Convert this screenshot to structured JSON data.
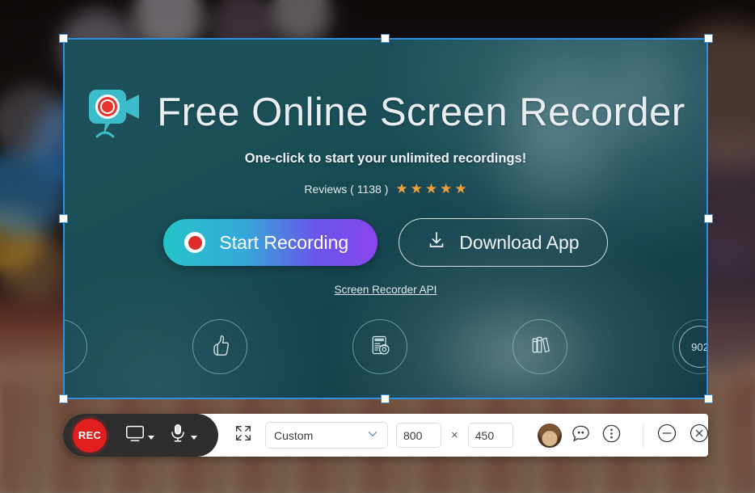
{
  "capture": {
    "logo_icon": "camcorder-record-logo",
    "title": "Free Online Screen Recorder",
    "subtitle": "One-click to start your unlimited recordings!",
    "reviews": {
      "label": "Reviews ( 1138 )",
      "count": 1138,
      "stars": 5,
      "star_glyph": "★",
      "star_color": "#f0a23c"
    },
    "buttons": {
      "start_recording": "Start Recording",
      "download_app": "Download App"
    },
    "api_link": "Screen Recorder API",
    "features": [
      {
        "name": "partial-left-circle",
        "icon": "circle-partial",
        "label": ""
      },
      {
        "name": "thumbs-up",
        "icon": "thumbs-up-icon",
        "label": ""
      },
      {
        "name": "screenshot",
        "icon": "screenshot-document-icon",
        "label": ""
      },
      {
        "name": "library",
        "icon": "books-icon",
        "label": ""
      },
      {
        "name": "counter",
        "icon": "progress-ring-icon",
        "label": "902"
      }
    ]
  },
  "toolbar": {
    "rec_label": "REC",
    "screen_icon": "monitor-icon",
    "screen_caret": "chevron-down-icon",
    "mic_icon": "microphone-icon",
    "mic_caret": "chevron-down-icon",
    "expand_icon": "fullscreen-expand-icon",
    "region_select": {
      "value": "Custom",
      "caret_icon": "chevron-down-icon"
    },
    "width": "800",
    "height": "450",
    "dimension_separator": "×",
    "avatar_icon": "user-avatar",
    "chat_icon": "chat-bubble-icon",
    "more_icon": "more-vertical-icon",
    "minimize_icon": "minimize-icon",
    "close_icon": "close-icon"
  },
  "selection": {
    "handles": 8,
    "border_color": "#2f8fe0",
    "handle_color": "#ffffff"
  }
}
